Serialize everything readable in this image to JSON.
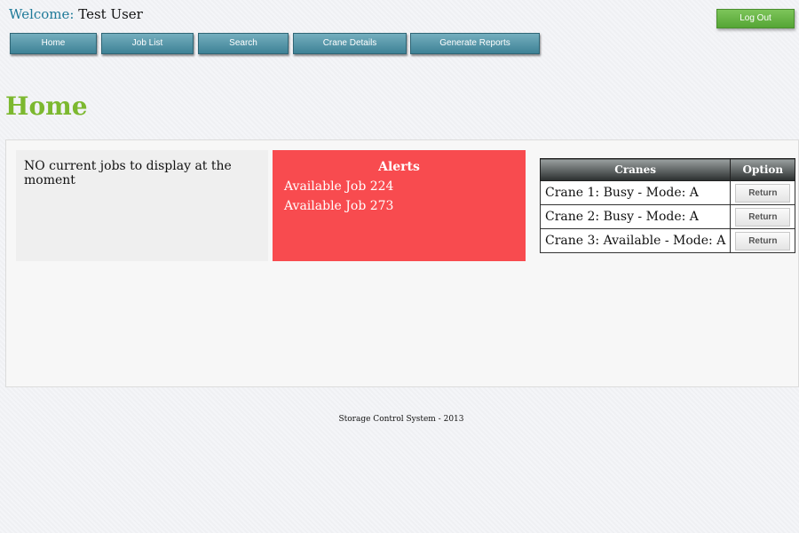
{
  "header": {
    "welcome_label": "Welcome:",
    "user_name": "Test User",
    "logout_label": "Log Out"
  },
  "nav": {
    "home": "Home",
    "job_list": "Job List",
    "search": "Search",
    "crane_details": "Crane Details",
    "generate_reports": "Generate Reports"
  },
  "page": {
    "title": "Home"
  },
  "jobs": {
    "message": "NO current jobs to display at the moment"
  },
  "alerts": {
    "title": "Alerts",
    "items": [
      "Available Job 224",
      "Available Job 273"
    ]
  },
  "cranes": {
    "headers": [
      "Cranes",
      "Option"
    ],
    "rows": [
      {
        "label": "Crane 1: Busy - Mode: A",
        "option": "Return"
      },
      {
        "label": "Crane 2: Busy - Mode: A",
        "option": "Return"
      },
      {
        "label": "Crane 3: Available - Mode: A",
        "option": "Return"
      }
    ]
  },
  "footer": {
    "text": "Storage Control System - 2013"
  },
  "colors": {
    "title_green": "#7cb82f",
    "nav_teal": "#4a8ea2",
    "alert_red": "#f84b4f",
    "logout_green": "#62b043",
    "welcome_teal": "#1f7a99"
  }
}
